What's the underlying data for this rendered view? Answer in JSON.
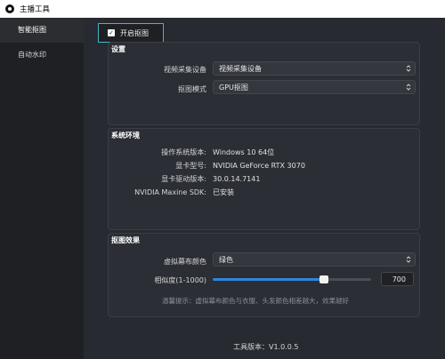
{
  "window": {
    "title": "主播工具"
  },
  "sidebar": {
    "items": [
      {
        "label": "智能抠图",
        "active": true
      },
      {
        "label": "自动水印",
        "active": false
      }
    ]
  },
  "toggle": {
    "label": "开启抠图",
    "checked": true
  },
  "settings": {
    "title": "设置",
    "capture_device": {
      "label": "视频采集设备",
      "value": "视频采集设备"
    },
    "matting_mode": {
      "label": "抠图模式",
      "value": "GPU抠图"
    }
  },
  "system": {
    "title": "系统环境",
    "rows": [
      {
        "key": "操作系统版本:",
        "value": "Windows 10 64位"
      },
      {
        "key": "显卡型号:",
        "value": "NVIDIA GeForce RTX 3070"
      },
      {
        "key": "显卡驱动版本:",
        "value": "30.0.14.7141"
      },
      {
        "key": "NVIDIA Maxine SDK:",
        "value": "已安装"
      }
    ]
  },
  "effect": {
    "title": "抠图效果",
    "bg_color": {
      "label": "虚拟幕布颜色",
      "value": "绿色"
    },
    "similarity": {
      "label": "相似度(1-1000)",
      "value": "700",
      "fraction": 0.7
    },
    "hint": "温馨提示：虚拟幕布颜色与衣服、头发颜色相差越大，效果越好"
  },
  "footer": {
    "version": "工具版本：V1.0.0.5"
  },
  "colors": {
    "accent": "#3fb9c7",
    "slider": "#2e86de"
  }
}
